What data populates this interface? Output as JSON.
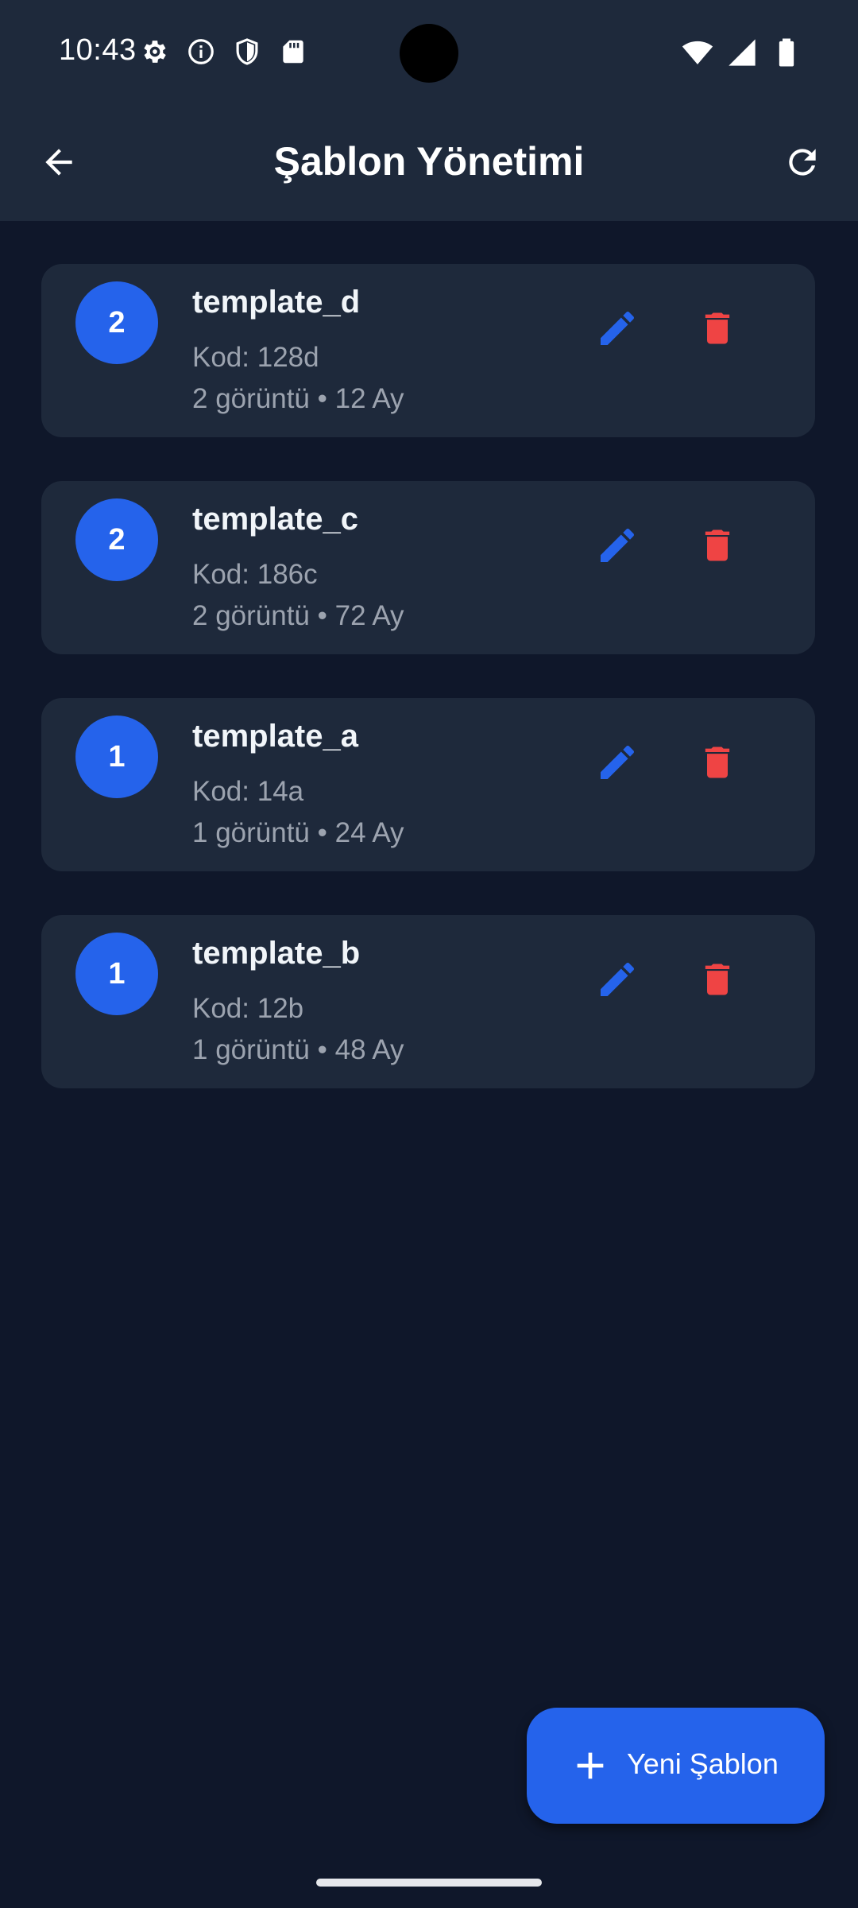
{
  "status_bar": {
    "time": "10:43",
    "left_icons": [
      "gear-icon",
      "info-icon",
      "shield-icon",
      "sd-card-icon"
    ],
    "right_icons": [
      "wifi-icon",
      "signal-icon",
      "battery-icon"
    ]
  },
  "app_bar": {
    "title": "Şablon Yönetimi",
    "back_icon": "arrow-left-icon",
    "refresh_icon": "refresh-icon"
  },
  "templates": [
    {
      "count": "2",
      "name": "template_d",
      "code": "Kod:  128d",
      "meta": "2 görüntü • 12 Ay"
    },
    {
      "count": "2",
      "name": "template_c",
      "code": "Kod:  186c",
      "meta": "2 görüntü • 72 Ay"
    },
    {
      "count": "1",
      "name": "template_a",
      "code": "Kod:  14a",
      "meta": "1 görüntü • 24 Ay"
    },
    {
      "count": "1",
      "name": "template_b",
      "code": "Kod:  12b",
      "meta": "1 görüntü • 48 Ay"
    }
  ],
  "fab": {
    "label": "Yeni Şablon",
    "icon": "plus-icon"
  },
  "colors": {
    "background": "#0f172a",
    "surface": "#1e293b",
    "accent": "#2563eb",
    "danger": "#ef4444",
    "muted_text": "#9ca3af"
  }
}
